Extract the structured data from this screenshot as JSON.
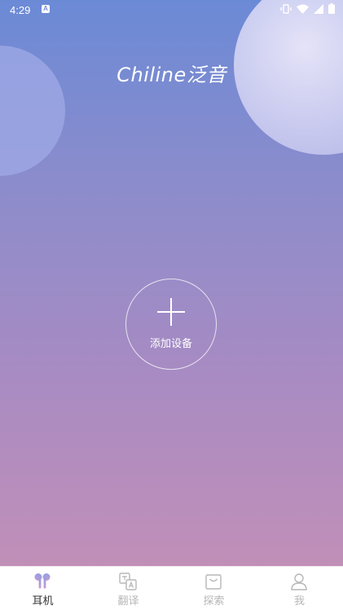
{
  "status_bar": {
    "time": "4:29",
    "notification_icon": "A",
    "icons": [
      "vibrate-icon",
      "wifi-icon",
      "signal-icon",
      "battery-icon"
    ]
  },
  "brand": {
    "logo_text": "Chiline泛音"
  },
  "main": {
    "add_device_label": "添加设备",
    "add_icon": "plus-icon"
  },
  "tabs": [
    {
      "label": "耳机",
      "icon": "earbuds-icon",
      "active": true
    },
    {
      "label": "翻译",
      "icon": "translate-icon",
      "active": false
    },
    {
      "label": "探索",
      "icon": "shopping-bag-icon",
      "active": false
    },
    {
      "label": "我",
      "icon": "person-icon",
      "active": false
    }
  ],
  "colors": {
    "gradient_top": "#6b8ad6",
    "gradient_bottom": "#c18fb8",
    "tab_active": "#333333",
    "tab_inactive": "#b7b7b7",
    "earbuds_icon_top": "#8fa0e6",
    "earbuds_icon_bottom": "#c79ad0"
  }
}
